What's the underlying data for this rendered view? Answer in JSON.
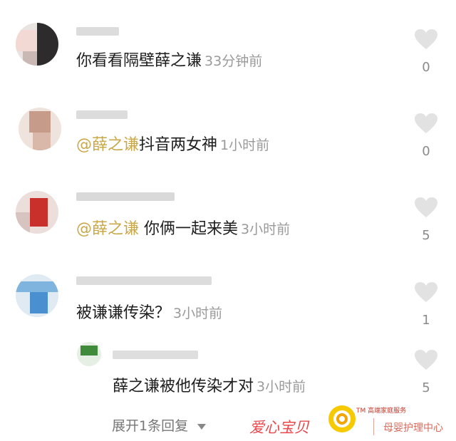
{
  "comments": [
    {
      "text_prefix": "",
      "mention": "",
      "text": "你看看隔壁薛之谦",
      "time": "33分钟前",
      "likes": "0"
    },
    {
      "text_prefix": "",
      "mention": "@薛之谦",
      "text": "抖音两女神",
      "time": "1小时前",
      "likes": "0"
    },
    {
      "text_prefix": "",
      "mention": "@薛之谦",
      "text": " 你俩一起来美",
      "time": "3小时前",
      "likes": "5"
    },
    {
      "text_prefix": "",
      "mention": "",
      "text": "被谦谦传染？",
      "time": "3小时前",
      "likes": "1"
    }
  ],
  "reply": {
    "text": "薛之谦被他传染才对",
    "time": "3小时前",
    "likes": "5"
  },
  "expand_label": "展开1条回复",
  "expand_icon": "triangle-down-icon",
  "like_icon": "heart-icon",
  "watermark": {
    "brand": "爱心宝贝",
    "tm_line": "TM 高端家庭服务",
    "sub": "母婴护理中心"
  },
  "colors": {
    "mention": "#c9a84a",
    "time": "#9a9a9a",
    "heart": "#e2e2e2",
    "brand": "#e8484c"
  }
}
